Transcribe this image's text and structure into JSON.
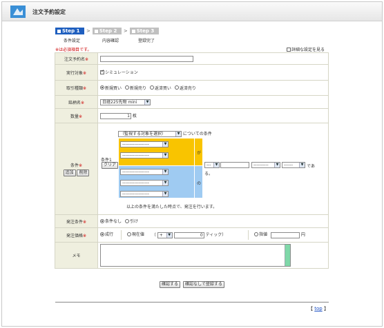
{
  "title": "注文予約設定",
  "steps": [
    {
      "label": "Step 1",
      "caption": "条件設定",
      "active": true
    },
    {
      "label": "Step 2",
      "caption": "内容確認",
      "active": false
    },
    {
      "label": "Step 3",
      "caption": "登録完了",
      "active": false
    }
  ],
  "step_sep": ">",
  "required_note": "※は必須項目です。",
  "detail_label": "詳細な設定を見る",
  "required_mark": "※",
  "fields": {
    "order_name": {
      "label": "注文予約名"
    },
    "execution": {
      "label": "実行対象",
      "checkbox_label": "シミュレーション"
    },
    "trade_type": {
      "label": "取引種類",
      "options": [
        "新規買い",
        "新規売り",
        "返済買い",
        "返済売り"
      ],
      "selected": 0
    },
    "symbol": {
      "label": "銘柄名",
      "value": "日経225先物 mini"
    },
    "quantity": {
      "label": "数量",
      "value": "1",
      "unit": "枚"
    },
    "condition": {
      "label": "条件",
      "add_button": "追加",
      "delete_button": "削除",
      "target_select": "（監視する対象を選択）",
      "target_suffix": "についての条件",
      "cond_label": "条件1",
      "clear_button": "クリア",
      "dash_select": "------------------",
      "ga": "が",
      "no": "の",
      "op_select": "---",
      "compare_select": "----------",
      "tail_select": "------",
      "tail_text": "であ",
      "tail_text2": "る。",
      "footer": "以上の条件を満たした時点で、発注を行います。"
    },
    "order_condition": {
      "label": "発注条件",
      "options": [
        "条件なし",
        "引け"
      ],
      "selected": 0
    },
    "order_price": {
      "label": "発注価格",
      "market": "成行",
      "current": "現在値",
      "paren_open": "（",
      "sign": "+",
      "tick_value": "0",
      "tick_suffix": "ティック）",
      "limit": "指値",
      "yen": "円"
    },
    "memo": {
      "label": "メモ"
    }
  },
  "buttons": {
    "confirm": "確認する",
    "register": "確認なしで登録する"
  },
  "top_link": {
    "open": "【",
    "label": "top",
    "close": "】"
  }
}
